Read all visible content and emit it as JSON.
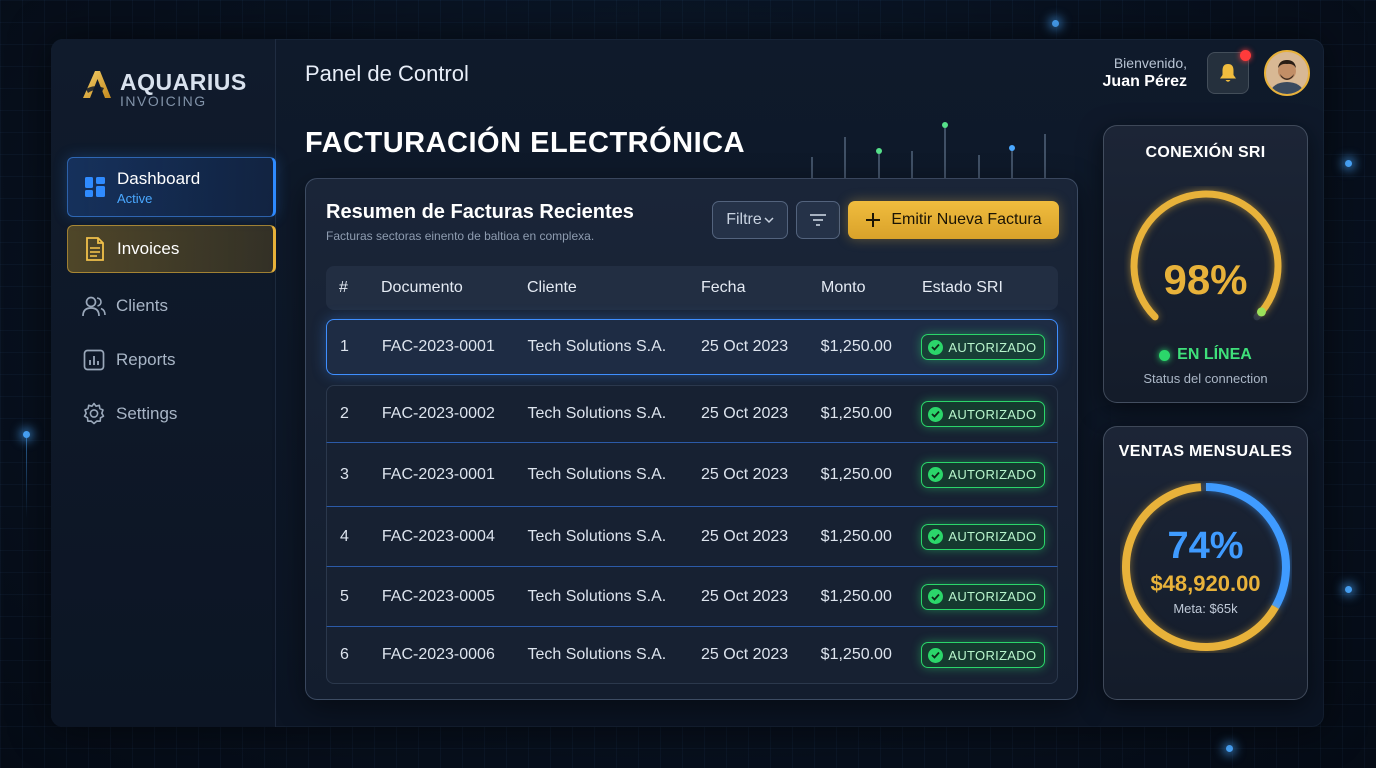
{
  "brand": {
    "name": "AQUARIUS",
    "tagline": "INVOICING"
  },
  "header": {
    "page_title": "Panel de Control",
    "welcome": "Bienvenido,",
    "user_name": "Juan Pérez"
  },
  "sidebar": {
    "items": [
      {
        "label": "Dashboard",
        "sub": "Active",
        "icon": "dashboard-grid-icon"
      },
      {
        "label": "Invoices",
        "icon": "document-icon"
      },
      {
        "label": "Clients",
        "icon": "users-icon"
      },
      {
        "label": "Reports",
        "icon": "chart-icon"
      },
      {
        "label": "Settings",
        "icon": "gear-icon"
      }
    ]
  },
  "main": {
    "section_title": "FACTURACIÓN ELECTRÓNICA",
    "panel": {
      "title": "Resumen de Facturas Recientes",
      "subtitle": "Facturas sectoras einento de baltioa en complexa.",
      "filter_label": "Filtre",
      "emit_label": "Emitir Nueva Factura",
      "columns": [
        "#",
        "Documento",
        "Cliente",
        "Fecha",
        "Monto",
        "Estado SRI"
      ],
      "rows": [
        {
          "num": "1",
          "doc": "FAC-2023-0001",
          "client": "Tech Solutions S.A.",
          "date": "25 Oct 2023",
          "amount": "$1,250.00",
          "status": "AUTORIZADO"
        },
        {
          "num": "2",
          "doc": "FAC-2023-0002",
          "client": "Tech Solutions S.A.",
          "date": "25 Oct 2023",
          "amount": "$1,250.00",
          "status": "AUTORIZADO"
        },
        {
          "num": "3",
          "doc": "FAC-2023-0001",
          "client": "Tech Solutions S.A.",
          "date": "25 Oct 2023",
          "amount": "$1,250.00",
          "status": "AUTORIZADO"
        },
        {
          "num": "4",
          "doc": "FAC-2023-0004",
          "client": "Tech Solutions S.A.",
          "date": "25 Oct 2023",
          "amount": "$1,250.00",
          "status": "AUTORIZADO"
        },
        {
          "num": "5",
          "doc": "FAC-2023-0005",
          "client": "Tech Solutions S.A.",
          "date": "25 Oct 2023",
          "amount": "$1,250.00",
          "status": "AUTORIZADO"
        },
        {
          "num": "6",
          "doc": "FAC-2023-0006",
          "client": "Tech Solutions S.A.",
          "date": "25 Oct 2023",
          "amount": "$1,250.00",
          "status": "AUTORIZADO"
        }
      ]
    }
  },
  "sri_card": {
    "title": "CONEXIÓN SRI",
    "percent_text": "98%",
    "percent_value": 98,
    "online_text": "EN LÍNEA",
    "status_text": "Status del connection"
  },
  "sales_card": {
    "title": "VENTAS MENSUALES",
    "percent_text": "74%",
    "percent_value": 74,
    "amount": "$48,920.00",
    "meta": "Meta: $65k"
  },
  "colors": {
    "accent_gold": "#e8b23a",
    "accent_blue": "#3f9bff",
    "status_green": "#2bd66a",
    "notification_red": "#ff3b3b"
  }
}
